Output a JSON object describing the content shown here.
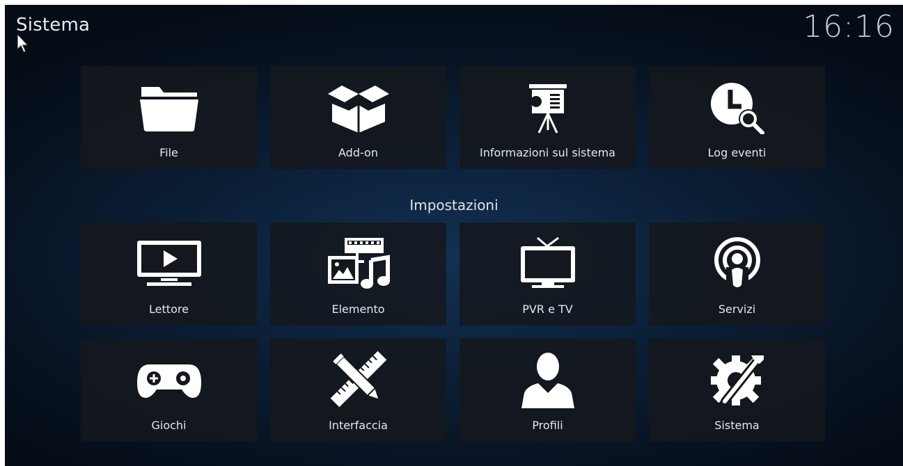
{
  "header": {
    "title": "Sistema",
    "clock": "16:16"
  },
  "top_tiles": [
    {
      "label": "File",
      "icon": "folder-icon"
    },
    {
      "label": "Add-on",
      "icon": "addon-box-icon"
    },
    {
      "label": "Informazioni sul sistema",
      "icon": "presentation-board-icon"
    },
    {
      "label": "Log eventi",
      "icon": "clock-search-icon"
    }
  ],
  "settings_section": {
    "title": "Impostazioni"
  },
  "settings_tiles": [
    {
      "label": "Lettore",
      "icon": "player-monitor-icon"
    },
    {
      "label": "Elemento",
      "icon": "media-icon"
    },
    {
      "label": "PVR e TV",
      "icon": "tv-icon"
    },
    {
      "label": "Servizi",
      "icon": "podcast-icon"
    },
    {
      "label": "Giochi",
      "icon": "gamepad-icon"
    },
    {
      "label": "Interfaccia",
      "icon": "pencil-ruler-icon"
    },
    {
      "label": "Profili",
      "icon": "user-profile-icon"
    },
    {
      "label": "Sistema",
      "icon": "gear-wrench-icon"
    }
  ],
  "colors": {
    "background": "#0b1e35",
    "tile": "#14181e",
    "text": "#e4e8ec"
  }
}
